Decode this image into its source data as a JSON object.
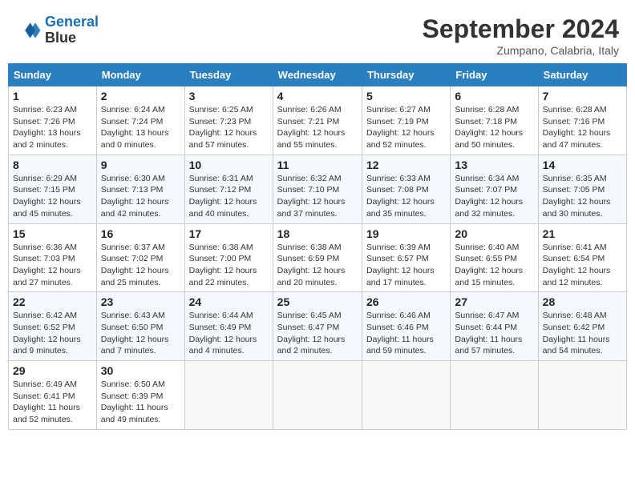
{
  "header": {
    "logo_line1": "General",
    "logo_line2": "Blue",
    "month": "September 2024",
    "location": "Zumpano, Calabria, Italy"
  },
  "weekdays": [
    "Sunday",
    "Monday",
    "Tuesday",
    "Wednesday",
    "Thursday",
    "Friday",
    "Saturday"
  ],
  "weeks": [
    [
      {
        "day": "1",
        "lines": [
          "Sunrise: 6:23 AM",
          "Sunset: 7:26 PM",
          "Daylight: 13 hours",
          "and 2 minutes."
        ]
      },
      {
        "day": "2",
        "lines": [
          "Sunrise: 6:24 AM",
          "Sunset: 7:24 PM",
          "Daylight: 13 hours",
          "and 0 minutes."
        ]
      },
      {
        "day": "3",
        "lines": [
          "Sunrise: 6:25 AM",
          "Sunset: 7:23 PM",
          "Daylight: 12 hours",
          "and 57 minutes."
        ]
      },
      {
        "day": "4",
        "lines": [
          "Sunrise: 6:26 AM",
          "Sunset: 7:21 PM",
          "Daylight: 12 hours",
          "and 55 minutes."
        ]
      },
      {
        "day": "5",
        "lines": [
          "Sunrise: 6:27 AM",
          "Sunset: 7:19 PM",
          "Daylight: 12 hours",
          "and 52 minutes."
        ]
      },
      {
        "day": "6",
        "lines": [
          "Sunrise: 6:28 AM",
          "Sunset: 7:18 PM",
          "Daylight: 12 hours",
          "and 50 minutes."
        ]
      },
      {
        "day": "7",
        "lines": [
          "Sunrise: 6:28 AM",
          "Sunset: 7:16 PM",
          "Daylight: 12 hours",
          "and 47 minutes."
        ]
      }
    ],
    [
      {
        "day": "8",
        "lines": [
          "Sunrise: 6:29 AM",
          "Sunset: 7:15 PM",
          "Daylight: 12 hours",
          "and 45 minutes."
        ]
      },
      {
        "day": "9",
        "lines": [
          "Sunrise: 6:30 AM",
          "Sunset: 7:13 PM",
          "Daylight: 12 hours",
          "and 42 minutes."
        ]
      },
      {
        "day": "10",
        "lines": [
          "Sunrise: 6:31 AM",
          "Sunset: 7:12 PM",
          "Daylight: 12 hours",
          "and 40 minutes."
        ]
      },
      {
        "day": "11",
        "lines": [
          "Sunrise: 6:32 AM",
          "Sunset: 7:10 PM",
          "Daylight: 12 hours",
          "and 37 minutes."
        ]
      },
      {
        "day": "12",
        "lines": [
          "Sunrise: 6:33 AM",
          "Sunset: 7:08 PM",
          "Daylight: 12 hours",
          "and 35 minutes."
        ]
      },
      {
        "day": "13",
        "lines": [
          "Sunrise: 6:34 AM",
          "Sunset: 7:07 PM",
          "Daylight: 12 hours",
          "and 32 minutes."
        ]
      },
      {
        "day": "14",
        "lines": [
          "Sunrise: 6:35 AM",
          "Sunset: 7:05 PM",
          "Daylight: 12 hours",
          "and 30 minutes."
        ]
      }
    ],
    [
      {
        "day": "15",
        "lines": [
          "Sunrise: 6:36 AM",
          "Sunset: 7:03 PM",
          "Daylight: 12 hours",
          "and 27 minutes."
        ]
      },
      {
        "day": "16",
        "lines": [
          "Sunrise: 6:37 AM",
          "Sunset: 7:02 PM",
          "Daylight: 12 hours",
          "and 25 minutes."
        ]
      },
      {
        "day": "17",
        "lines": [
          "Sunrise: 6:38 AM",
          "Sunset: 7:00 PM",
          "Daylight: 12 hours",
          "and 22 minutes."
        ]
      },
      {
        "day": "18",
        "lines": [
          "Sunrise: 6:38 AM",
          "Sunset: 6:59 PM",
          "Daylight: 12 hours",
          "and 20 minutes."
        ]
      },
      {
        "day": "19",
        "lines": [
          "Sunrise: 6:39 AM",
          "Sunset: 6:57 PM",
          "Daylight: 12 hours",
          "and 17 minutes."
        ]
      },
      {
        "day": "20",
        "lines": [
          "Sunrise: 6:40 AM",
          "Sunset: 6:55 PM",
          "Daylight: 12 hours",
          "and 15 minutes."
        ]
      },
      {
        "day": "21",
        "lines": [
          "Sunrise: 6:41 AM",
          "Sunset: 6:54 PM",
          "Daylight: 12 hours",
          "and 12 minutes."
        ]
      }
    ],
    [
      {
        "day": "22",
        "lines": [
          "Sunrise: 6:42 AM",
          "Sunset: 6:52 PM",
          "Daylight: 12 hours",
          "and 9 minutes."
        ]
      },
      {
        "day": "23",
        "lines": [
          "Sunrise: 6:43 AM",
          "Sunset: 6:50 PM",
          "Daylight: 12 hours",
          "and 7 minutes."
        ]
      },
      {
        "day": "24",
        "lines": [
          "Sunrise: 6:44 AM",
          "Sunset: 6:49 PM",
          "Daylight: 12 hours",
          "and 4 minutes."
        ]
      },
      {
        "day": "25",
        "lines": [
          "Sunrise: 6:45 AM",
          "Sunset: 6:47 PM",
          "Daylight: 12 hours",
          "and 2 minutes."
        ]
      },
      {
        "day": "26",
        "lines": [
          "Sunrise: 6:46 AM",
          "Sunset: 6:46 PM",
          "Daylight: 11 hours",
          "and 59 minutes."
        ]
      },
      {
        "day": "27",
        "lines": [
          "Sunrise: 6:47 AM",
          "Sunset: 6:44 PM",
          "Daylight: 11 hours",
          "and 57 minutes."
        ]
      },
      {
        "day": "28",
        "lines": [
          "Sunrise: 6:48 AM",
          "Sunset: 6:42 PM",
          "Daylight: 11 hours",
          "and 54 minutes."
        ]
      }
    ],
    [
      {
        "day": "29",
        "lines": [
          "Sunrise: 6:49 AM",
          "Sunset: 6:41 PM",
          "Daylight: 11 hours",
          "and 52 minutes."
        ]
      },
      {
        "day": "30",
        "lines": [
          "Sunrise: 6:50 AM",
          "Sunset: 6:39 PM",
          "Daylight: 11 hours",
          "and 49 minutes."
        ]
      },
      null,
      null,
      null,
      null,
      null
    ]
  ]
}
